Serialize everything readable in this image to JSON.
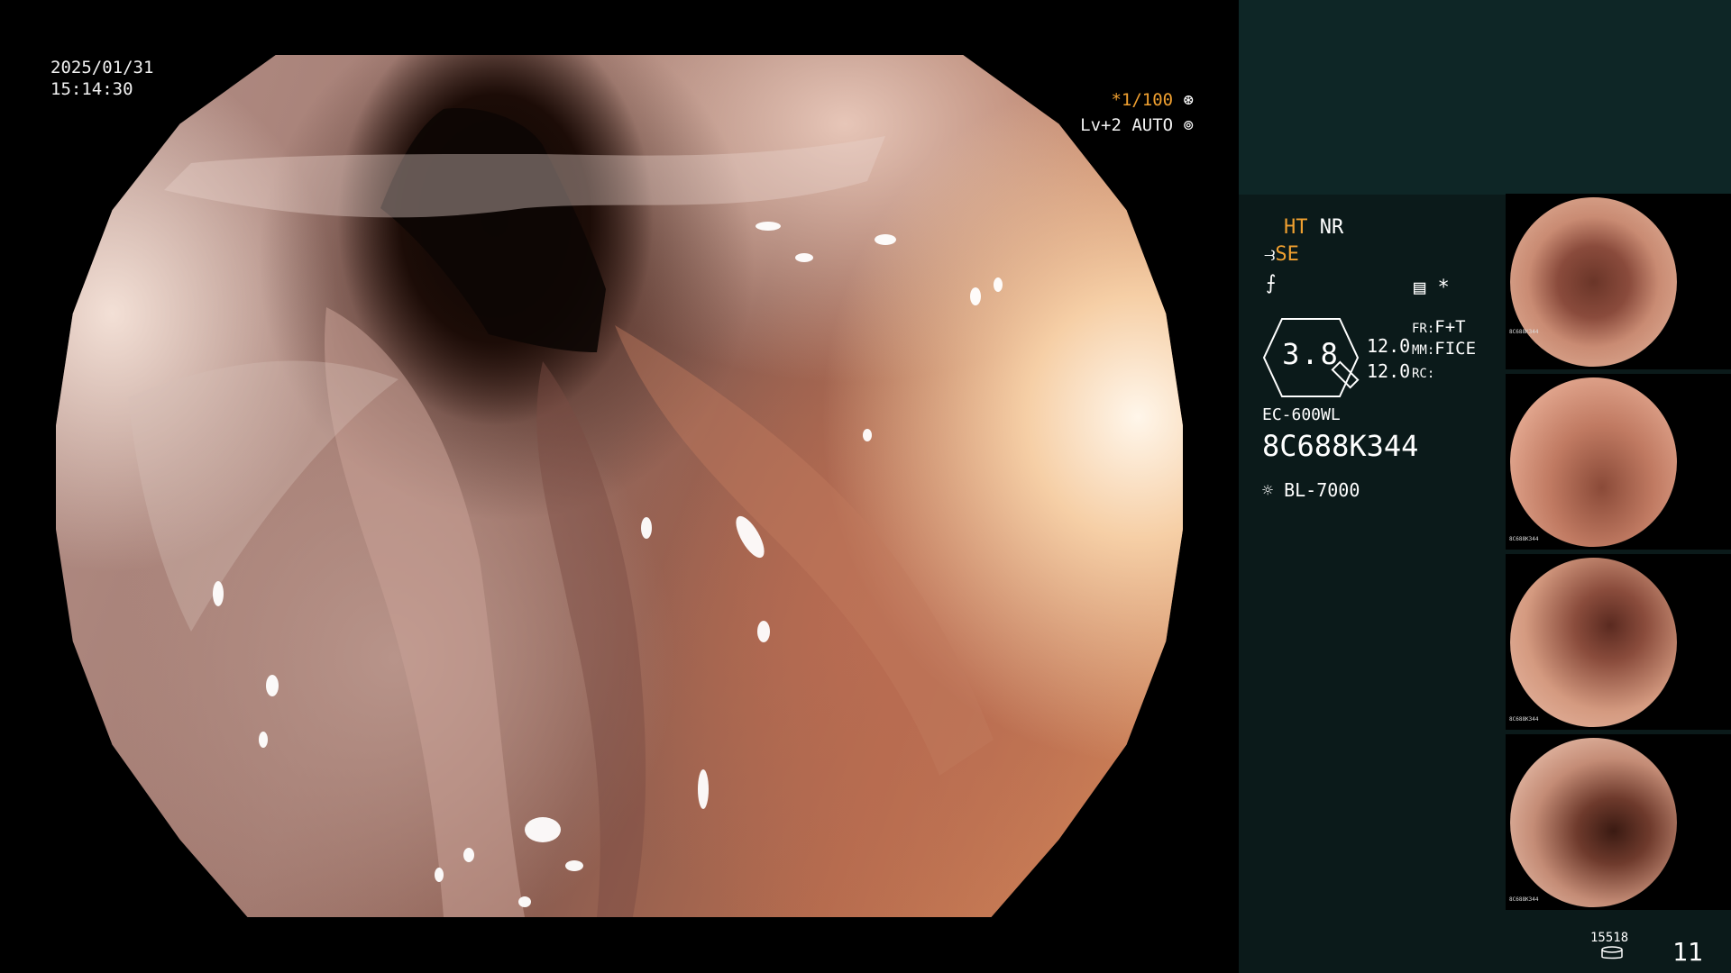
{
  "overlay": {
    "date": "2025/01/31",
    "time": "15:14:30",
    "shutter": "*1/100",
    "level": "Lv+2 AUTO"
  },
  "status": {
    "ht": "HT",
    "nr": "NR",
    "se": "SE",
    "zoom": "3.8",
    "val1": "12.0",
    "val2": "12.0",
    "fr_label": "FR:",
    "fr_value": "F+T",
    "mm_label": "MM:",
    "mm_value": "FICE",
    "rc_label": "RC:",
    "scope_model": "EC-600WL",
    "serial": "8C688K344",
    "light_source": "BL-7000",
    "asterisk": "*"
  },
  "thumbnails": [
    {
      "label": "8C688K344",
      "colors": [
        "#c98b73",
        "#8a4b3c"
      ]
    },
    {
      "label": "8C688K344",
      "colors": [
        "#d99880",
        "#a2604c"
      ]
    },
    {
      "label": "8C688K344",
      "colors": [
        "#d3987e",
        "#7a4032"
      ]
    },
    {
      "label": "8C688K344",
      "colors": [
        "#d4a08a",
        "#6e3a2c"
      ]
    }
  ],
  "footer": {
    "counter": "15518",
    "page": "11"
  },
  "colors": {
    "accent": "#f0a030",
    "panel_bg": "#0b1a1a",
    "top_box_bg": "#0e2626"
  }
}
